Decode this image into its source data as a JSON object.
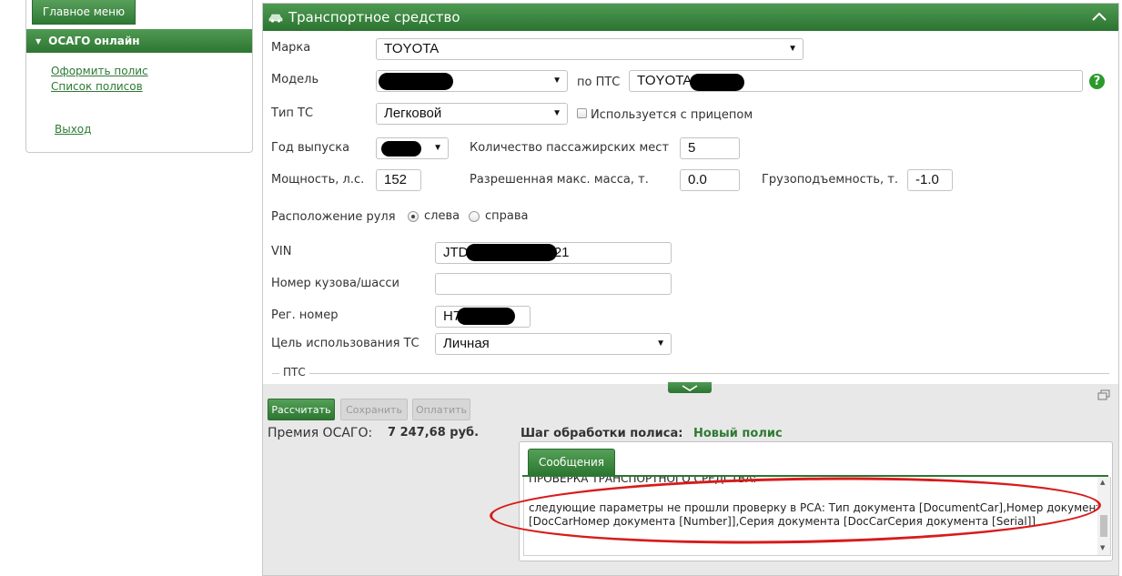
{
  "left_menu": {
    "main_menu_label": "Главное меню",
    "section_label": "ОСАГО онлайн",
    "links": [
      "Оформить полис",
      "Список полисов"
    ],
    "exit_label": "Выход"
  },
  "vehicle": {
    "title": "Транспортное средство",
    "make_label": "Марка",
    "make_value": "TOYOTA",
    "model_label": "Модель",
    "model_value": "",
    "pts_label": "по ПТС",
    "pts_value": "TOYOTA",
    "type_label": "Тип ТС",
    "type_value": "Легковой",
    "trailer_label": "Используется с прицепом",
    "year_label": "Год выпуска",
    "year_value": "",
    "seats_label": "Количество пассажирских мест",
    "seats_value": "5",
    "power_label": "Мощность, л.с.",
    "power_value": "152",
    "max_mass_label": "Разрешенная макс. масса, т.",
    "max_mass_value": "0.0",
    "capacity_label": "Грузоподъемность, т.",
    "capacity_value": "-1.0",
    "wheel_label": "Расположение руля",
    "wheel_left": "слева",
    "wheel_right": "справа",
    "vin_label": "VIN",
    "vin_prefix": "JTD",
    "vin_suffix": "221",
    "body_label": "Номер кузова/шасси",
    "body_value": "",
    "reg_label": "Рег. номер",
    "reg_value": "H7",
    "purpose_label": "Цель использования ТС",
    "purpose_value": "Личная",
    "pts_section_label": "ПТС"
  },
  "actions": {
    "calculate": "Рассчитать",
    "save": "Сохранить",
    "pay": "Оплатить"
  },
  "premium": {
    "label": "Премия ОСАГО:",
    "value": "7 247,68 руб."
  },
  "step": {
    "label": "Шаг обработки полиса:",
    "value": "Новый полис"
  },
  "messages": {
    "tab_label": "Сообщения",
    "lines": [
      "ПРОВЕРКА ТРАНСПОРТНОГО СРЕДСТВА:",
      "следующие параметры не прошли проверку в РСА: Тип документа [DocumentCar],Номер документа",
      "[DocCarНомер документа [Number]],Серия документа [DocCarСерия документа [Serial]]"
    ]
  },
  "colors": {
    "accent_green": "#2e7a33",
    "highlight_red": "#d81b1b"
  }
}
